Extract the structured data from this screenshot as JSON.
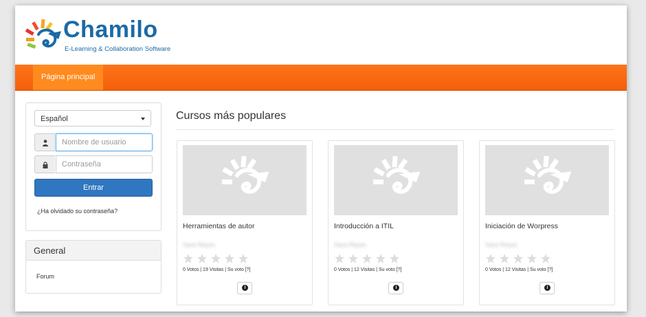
{
  "brand": {
    "name": "Chamilo",
    "tagline": "E-Learning & Collaboration Software",
    "colors": {
      "primary": "#1b6aa5",
      "nav": "#f36c10",
      "button": "#2f77c0"
    }
  },
  "nav": {
    "items": [
      {
        "label": "Página principal"
      }
    ]
  },
  "login": {
    "language": "Español",
    "username_placeholder": "Nombre de usuario",
    "password_placeholder": "Contraseña",
    "submit_label": "Entrar",
    "forgot_label": "¿Ha olvidado su contraseña?",
    "icons": {
      "user": "user-icon",
      "password": "lock-icon"
    }
  },
  "general": {
    "title": "General",
    "links": [
      {
        "label": "Forum"
      }
    ]
  },
  "courses": {
    "title": "Cursos más populares",
    "items": [
      {
        "title": "Herramientas de autor",
        "teacher": "Sara Reyes",
        "stats": "0 Votos | 19 Visitas | Su voto [?]"
      },
      {
        "title": "Introducción a ITIL",
        "teacher": "Sara Reyes",
        "stats": "0 Votos | 12 Visitas | Su voto [?]"
      },
      {
        "title": "Iniciación de Worpress",
        "teacher": "Sara Reyes",
        "stats": "0 Votos | 12 Visitas | Su voto [?]"
      }
    ]
  }
}
